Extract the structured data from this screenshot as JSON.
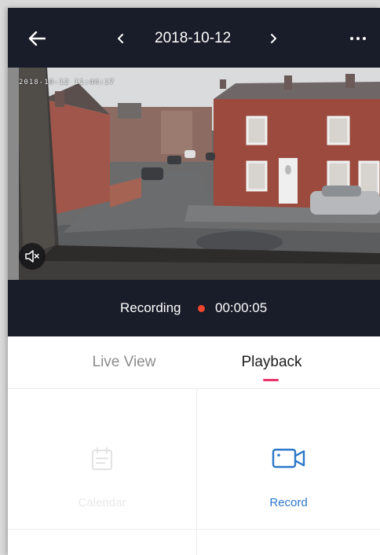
{
  "header": {
    "back_icon": "arrow-left-icon",
    "prev_icon": "chevron-left-icon",
    "date": "2018-10-12",
    "next_icon": "chevron-right-icon",
    "more_icon": "more-horizontal-icon"
  },
  "video": {
    "timestamp_overlay": "2018-10-12 11:44:17",
    "mute_icon": "speaker-muted-icon"
  },
  "recording": {
    "label": "Recording",
    "time": "00:00:05",
    "dot_color": "#f0462d"
  },
  "tabs": [
    {
      "label": "Live View",
      "active": false
    },
    {
      "label": "Playback",
      "active": true
    }
  ],
  "actions": {
    "calendar": {
      "label": "Calendar",
      "icon": "calendar-icon",
      "enabled": false
    },
    "record": {
      "label": "Record",
      "icon": "video-camera-icon",
      "enabled": true
    }
  },
  "colors": {
    "header_bg": "#191d29",
    "accent_pink": "#e8336a",
    "accent_blue": "#2c77c9"
  }
}
